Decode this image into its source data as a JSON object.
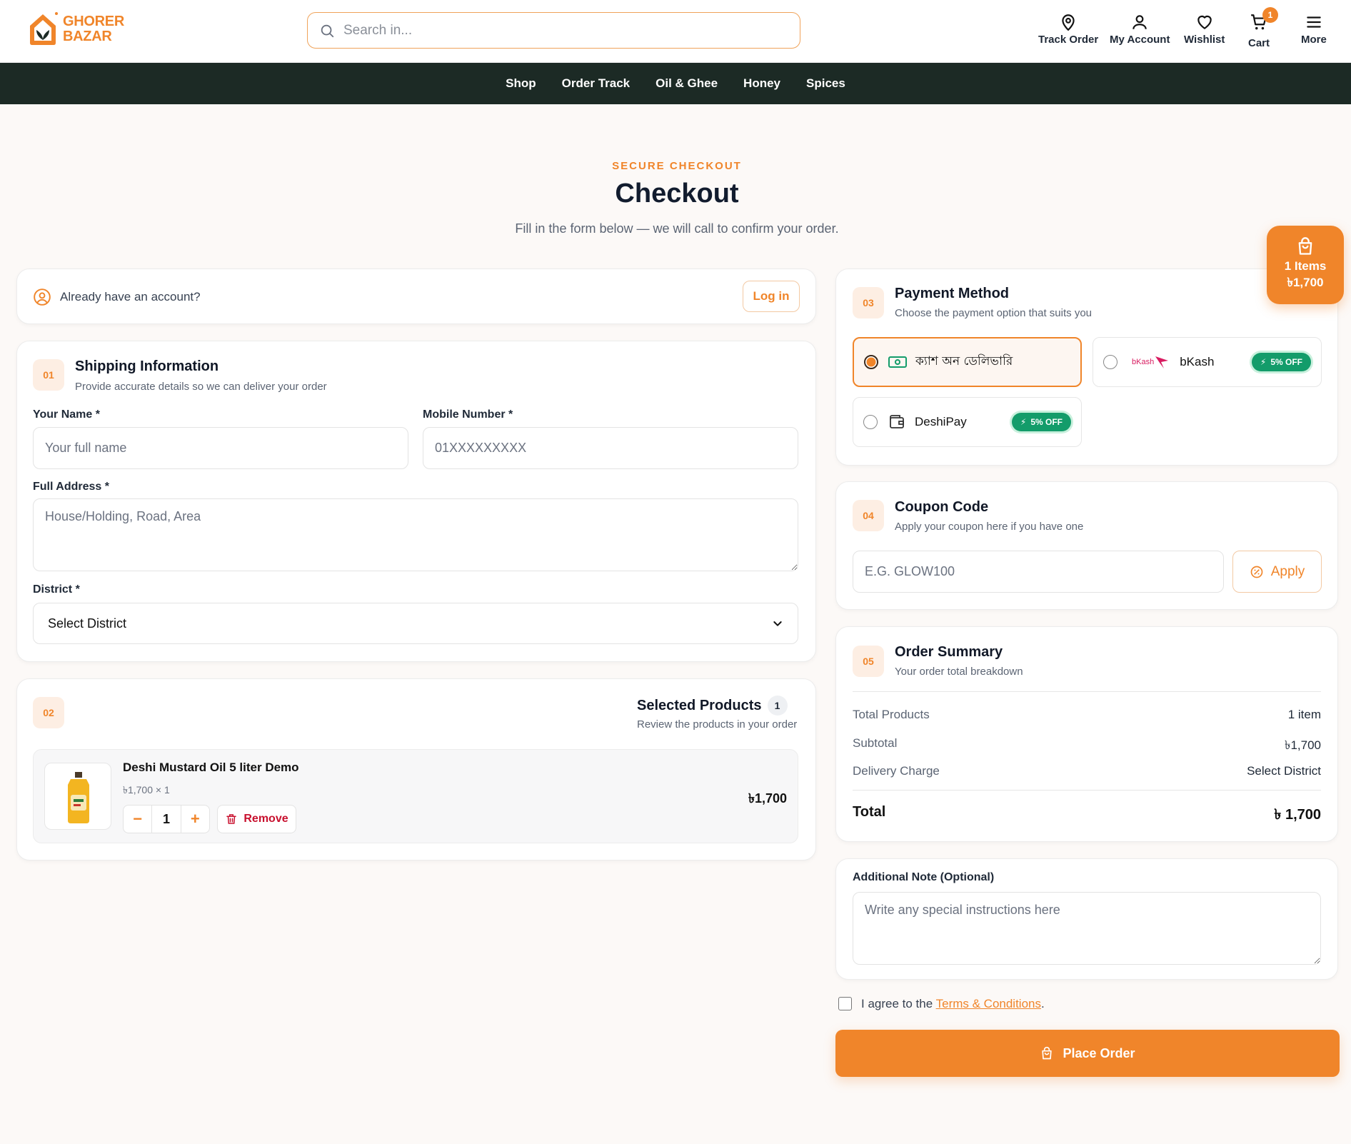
{
  "header": {
    "logo_line1": "GHORER",
    "logo_line2": "BAZAR",
    "search_placeholder": "Search in...",
    "actions": [
      {
        "label": "Track Order",
        "icon": "location-pin-icon"
      },
      {
        "label": "My Account",
        "icon": "user-icon"
      },
      {
        "label": "Wishlist",
        "icon": "heart-icon"
      },
      {
        "label": "Cart",
        "icon": "cart-icon",
        "badge": "1"
      },
      {
        "label": "More",
        "icon": "menu-icon"
      }
    ]
  },
  "nav": [
    "Shop",
    "Order Track",
    "Oil & Ghee",
    "Honey",
    "Spices"
  ],
  "hero": {
    "eyebrow": "SECURE CHECKOUT",
    "title": "Checkout",
    "subtitle": "Fill in the form below — we will call to confirm your order."
  },
  "account": {
    "text": "Already have an account?",
    "login_label": "Log in"
  },
  "shipping": {
    "step": "01",
    "title": "Shipping Information",
    "subtitle": "Provide accurate details so we can deliver your order",
    "name_label": "Your Name *",
    "name_placeholder": "Your full name",
    "mobile_label": "Mobile Number *",
    "mobile_placeholder": "01XXXXXXXXX",
    "address_label": "Full Address *",
    "address_placeholder": "House/Holding, Road, Area",
    "district_label": "District *",
    "district_value": "Select District"
  },
  "products": {
    "step": "02",
    "title": "Selected Products",
    "count": "1",
    "subtitle": "Review the products in your order",
    "items": [
      {
        "name": "Deshi Mustard Oil 5 liter Demo",
        "unit_line": "৳1,700 × 1",
        "qty": "1",
        "total": "৳1,700",
        "remove_label": "Remove"
      }
    ]
  },
  "payment": {
    "step": "03",
    "title": "Payment Method",
    "subtitle": "Choose the payment option that suits you",
    "options": [
      {
        "label": "ক্যাশ অন ডেলিভারি",
        "selected": true
      },
      {
        "label": "bKash",
        "badge": "5% OFF",
        "logo_text": "bKash"
      },
      {
        "label": "DeshiPay",
        "badge": "5% OFF"
      }
    ]
  },
  "coupon": {
    "step": "04",
    "title": "Coupon Code",
    "subtitle": "Apply your coupon here if you have one",
    "placeholder": "E.G. GLOW100",
    "apply_label": "Apply"
  },
  "summary": {
    "step": "05",
    "title": "Order Summary",
    "subtitle": "Your order total breakdown",
    "rows": [
      {
        "k": "Total Products",
        "v": "1 item"
      },
      {
        "k": "Subtotal",
        "v": "৳1,700"
      },
      {
        "k": "Delivery Charge",
        "v": "Select District"
      }
    ],
    "total_label": "Total",
    "total_value": "৳ 1,700"
  },
  "note": {
    "label": "Additional Note (Optional)",
    "placeholder": "Write any special instructions here"
  },
  "terms": {
    "prefix": "I agree to the ",
    "link": "Terms & Conditions",
    "suffix": "."
  },
  "place_order_label": "Place Order",
  "float_cart": {
    "items": "1 Items",
    "total": "৳1,700"
  },
  "colors": {
    "accent": "#f0852a",
    "nav_bg": "#1c2a25",
    "badge_green": "#139c6a"
  }
}
